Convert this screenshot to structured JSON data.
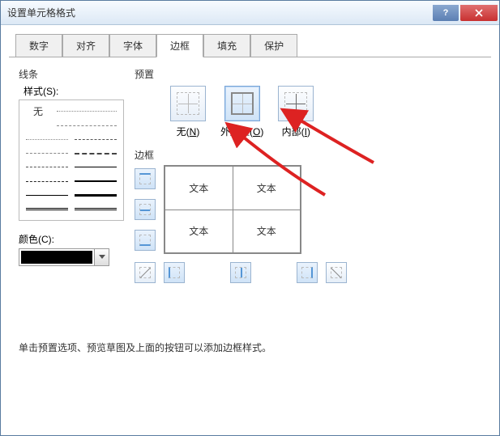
{
  "window": {
    "title": "设置单元格格式"
  },
  "tabs": [
    "数字",
    "对齐",
    "字体",
    "边框",
    "填充",
    "保护"
  ],
  "active_tab_index": 3,
  "line": {
    "group": "线条",
    "style_label": "样式(S):",
    "none": "无",
    "color_label": "颜色(C):",
    "color_value": "#000000"
  },
  "preset": {
    "group": "预置",
    "items": [
      {
        "label": "无(N)"
      },
      {
        "label": "外边框(O)"
      },
      {
        "label": "内部(I)"
      }
    ]
  },
  "border": {
    "group": "边框",
    "cell_text": "文本"
  },
  "hint": "单击预置选项、预览草图及上面的按钮可以添加边框样式。"
}
